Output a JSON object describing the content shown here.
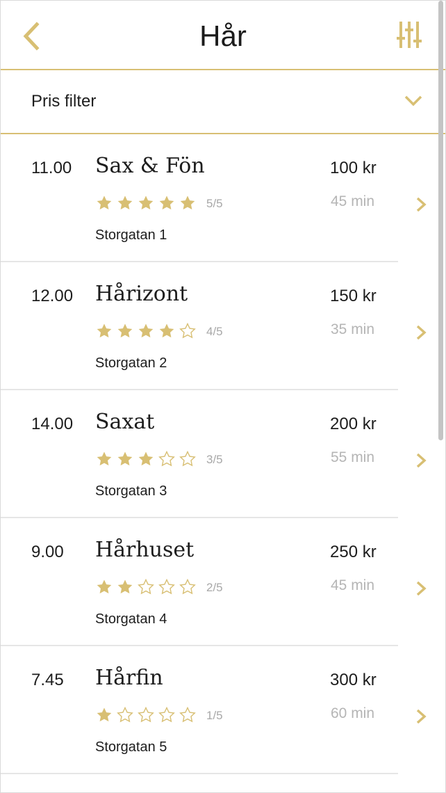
{
  "header": {
    "title": "Hår",
    "back_icon": "chevron-left-icon",
    "filter_icon": "sliders-icon"
  },
  "price_filter": {
    "label": "Pris filter",
    "icon": "chevron-down-icon"
  },
  "colors": {
    "accent": "#d8bf73",
    "muted_text": "#b5b5b5",
    "divider": "#e6e6e6"
  },
  "salons": [
    {
      "time": "11.00",
      "name": "Sax & Fön",
      "rating": 5,
      "rating_text": "5/5",
      "address": "Storgatan 1",
      "price": "100 kr",
      "duration": "45 min"
    },
    {
      "time": "12.00",
      "name": "Hårizont",
      "rating": 4,
      "rating_text": "4/5",
      "address": "Storgatan 2",
      "price": "150 kr",
      "duration": "35 min"
    },
    {
      "time": "14.00",
      "name": "Saxat",
      "rating": 3,
      "rating_text": "3/5",
      "address": "Storgatan 3",
      "price": "200 kr",
      "duration": "55 min"
    },
    {
      "time": "9.00",
      "name": "Hårhuset",
      "rating": 2,
      "rating_text": "2/5",
      "address": "Storgatan 4",
      "price": "250 kr",
      "duration": "45 min"
    },
    {
      "time": "7.45",
      "name": "Hårfin",
      "rating": 1,
      "rating_text": "1/5",
      "address": "Storgatan 5",
      "price": "300 kr",
      "duration": "60 min"
    }
  ]
}
